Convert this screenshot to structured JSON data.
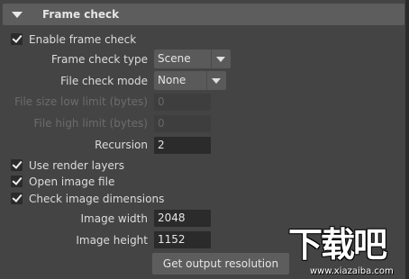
{
  "section": {
    "title": "Frame check"
  },
  "enable_frame_check": {
    "label": "Enable frame check",
    "checked": true
  },
  "frame_check_type": {
    "label": "Frame check type",
    "value": "Scene"
  },
  "file_check_mode": {
    "label": "File check mode",
    "value": "None"
  },
  "file_size_low_limit": {
    "label": "File size low limit (bytes)",
    "value": "0"
  },
  "file_high_limit": {
    "label": "File high limit (bytes)",
    "value": "0"
  },
  "recursion": {
    "label": "Recursion",
    "value": "2"
  },
  "use_render_layers": {
    "label": "Use render layers",
    "checked": true
  },
  "open_image_file": {
    "label": "Open image file",
    "checked": true
  },
  "check_image_dimensions": {
    "label": "Check image dimensions",
    "checked": true
  },
  "image_width": {
    "label": "Image width",
    "value": "2048"
  },
  "image_height": {
    "label": "Image height",
    "value": "1152"
  },
  "get_output_resolution": {
    "label": "Get output resolution"
  },
  "watermark": {
    "logo_text": "下载吧",
    "url": "www.xiazaiba.com"
  }
}
